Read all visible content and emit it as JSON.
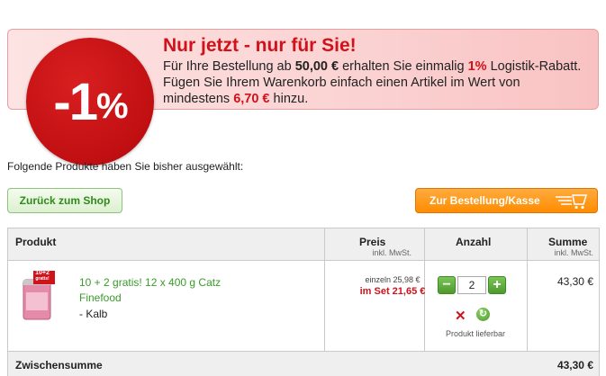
{
  "promo": {
    "badge_number": "-1",
    "badge_percent": "%",
    "title": "Nur jetzt - nur für Sie!",
    "line1_a": "Für Ihre Bestellung ab ",
    "line1_amount": "50,00 €",
    "line1_b": " erhalten Sie einmalig ",
    "line1_rate": "1%",
    "line1_c": " Logistik-Rabatt.",
    "line2": "Fügen Sie Ihrem Warenkorb einfach einen Artikel im Wert von",
    "line3_a": "mindestens ",
    "line3_amount": "6,70 €",
    "line3_b": " hinzu."
  },
  "intro": "Folgende Produkte haben Sie bisher ausgewählt:",
  "buttons": {
    "back": "Zurück zum Shop",
    "checkout": "Zur Bestellung/Kasse"
  },
  "table": {
    "headers": {
      "product": "Produkt",
      "price": "Preis",
      "price_sub": "inkl. MwSt.",
      "quantity": "Anzahl",
      "sum": "Summe",
      "sum_sub": "inkl. MwSt."
    },
    "row": {
      "badge": "10+2",
      "badge_sub": "gratis!",
      "name": "10 + 2 gratis! 12 x 400 g Catz Finefood",
      "variant": "- Kalb",
      "price_single": "einzeln 25,98 €",
      "price_set": "im Set 21,65 €",
      "quantity": "2",
      "status": "Produkt lieferbar",
      "total": "43,30 €"
    },
    "subtotal_label": "Zwischensumme",
    "subtotal_value": "43,30 €"
  },
  "colors": {
    "accent_red": "#d0121a",
    "green": "#3a9a2a",
    "orange": "#ff8c00"
  }
}
